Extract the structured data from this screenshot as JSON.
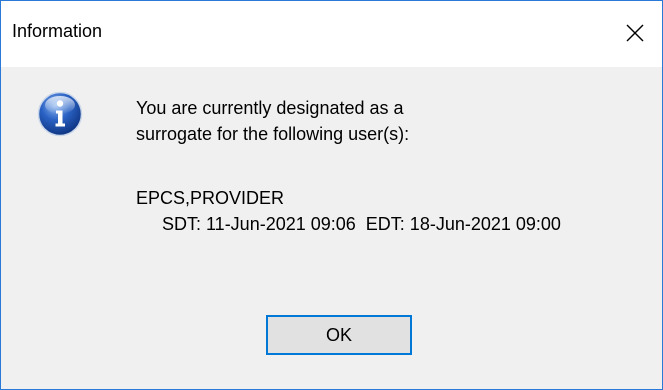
{
  "window": {
    "title": "Information",
    "close_icon": "close-icon",
    "accent_color": "#0078d7"
  },
  "message": {
    "icon": "information-icon",
    "line1": "You are currently designated as a",
    "line2": "surrogate for the following user(s):"
  },
  "surrogate": {
    "user": "EPCS,PROVIDER",
    "sdt": "SDT: 11-Jun-2021 09:06",
    "edt": "EDT: 18-Jun-2021 09:00"
  },
  "buttons": {
    "ok_label": "OK"
  }
}
